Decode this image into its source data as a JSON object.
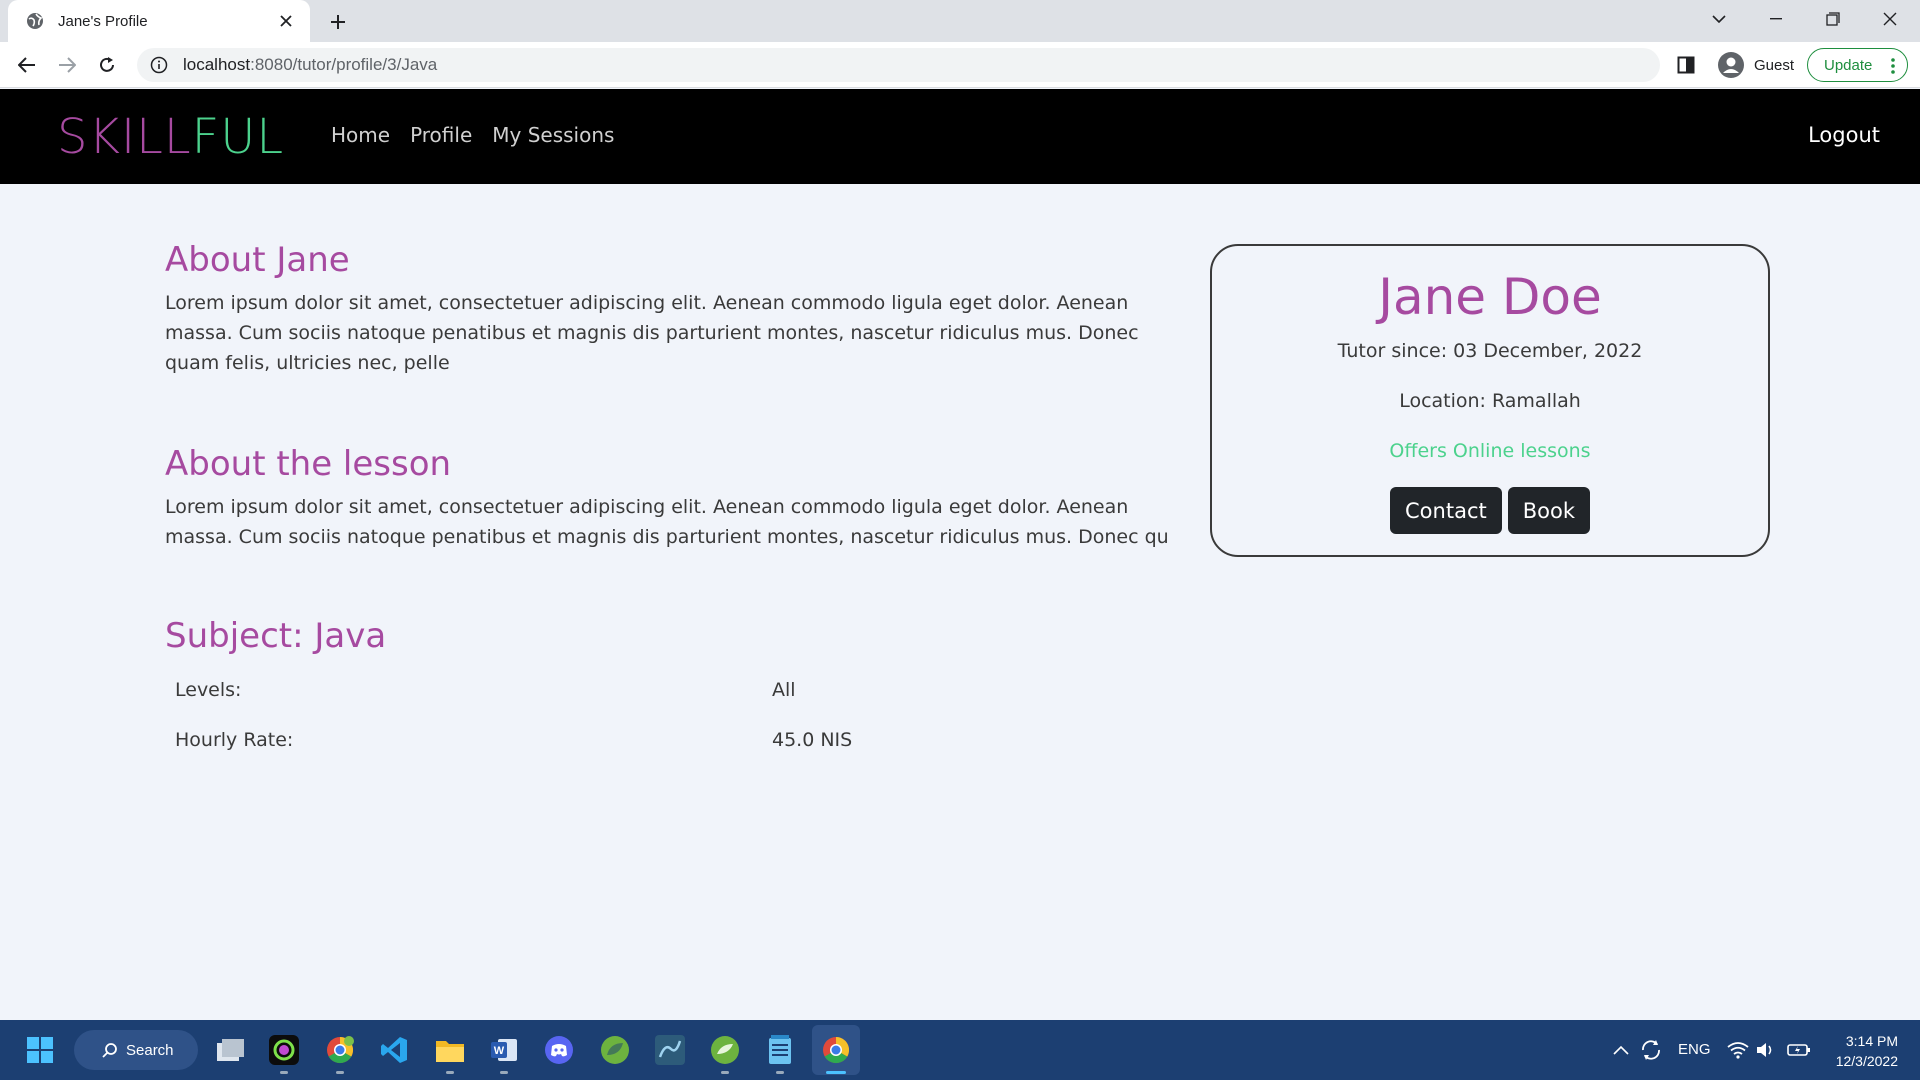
{
  "browser": {
    "tab_title": "Jane's Profile",
    "url_host": "localhost",
    "url_path": ":8080/tutor/profile/3/Java",
    "profile_name": "Guest",
    "update_label": "Update"
  },
  "nav": {
    "brand_part1": "SKILL",
    "brand_part2": "FUL",
    "brand_color1": "#a64aa0",
    "brand_color2": "#4cd28d",
    "links": [
      "Home",
      "Profile",
      "My Sessions"
    ],
    "logout": "Logout"
  },
  "about": {
    "heading": "About Jane",
    "text": "Lorem ipsum dolor sit amet, consectetuer adipiscing elit. Aenean commodo ligula eget dolor. Aenean massa. Cum sociis natoque penatibus et magnis dis parturient montes, nascetur ridiculus mus. Donec quam felis, ultricies nec, pelle"
  },
  "lesson": {
    "heading": "About the lesson",
    "text": "Lorem ipsum dolor sit amet, consectetuer adipiscing elit. Aenean commodo ligula eget dolor. Aenean massa. Cum sociis natoque penatibus et magnis dis parturient montes, nascetur ridiculus mus. Donec qu"
  },
  "subject": {
    "heading": "Subject: Java",
    "levels_label": "Levels:",
    "levels_value": "All",
    "rate_label": "Hourly Rate:",
    "rate_value": "45.0 NIS"
  },
  "card": {
    "name": "Jane Doe",
    "since": "Tutor since: 03 December, 2022",
    "location": "Location: Ramallah",
    "online": "Offers Online lessons",
    "contact_button": "Contact",
    "book_button": "Book"
  },
  "taskbar": {
    "search_label": "Search",
    "language": "ENG",
    "time": "3:14 PM",
    "date": "12/3/2022"
  }
}
